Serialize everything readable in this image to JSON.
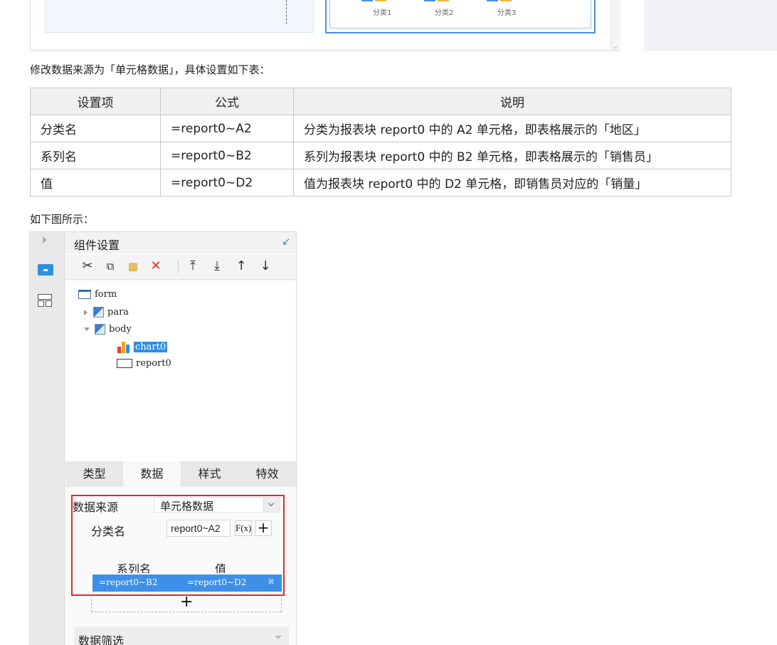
{
  "top_preview": {
    "categories": [
      "分类1",
      "分类2",
      "分类3"
    ]
  },
  "intro_text": "修改数据来源为「单元格数据」，具体设置如下表：",
  "settings_table": {
    "headers": [
      "设置项",
      "公式",
      "说明"
    ],
    "rows": [
      [
        "分类名",
        "=report0~A2",
        "分类为报表块 report0 中的 A2 单元格，即表格展示的「地区」"
      ],
      [
        "系列名",
        "=report0~B2",
        "系列为报表块 report0 中的 B2 单元格，即表格展示的「销售员」"
      ],
      [
        "值",
        "=report0~D2",
        "值为报表块 report0 中的 D2 单元格，即销售员对应的「销量」"
      ]
    ]
  },
  "caption_text": "如下图所示：",
  "designer": {
    "panel_title": "组件设置",
    "tree": {
      "root": "form",
      "para": "para",
      "body": "body",
      "chart": "chart0",
      "report": "report0"
    },
    "tabs": [
      "类型",
      "数据",
      "样式",
      "特效"
    ],
    "active_tab": "数据",
    "data_source_label": "数据来源",
    "data_source_value": "单元格数据",
    "category_label": "分类名",
    "category_value": "report0~A2",
    "fx_label": "F(x)",
    "series_header": "系列名",
    "value_header": "值",
    "series_formula": "=report0~B2",
    "value_formula": "=report0~D2",
    "filter_label": "数据筛选"
  },
  "colors": {
    "accent": "#2f8ee0",
    "highlight_box": "#e02b2b",
    "series_row": "#3d8fe8"
  }
}
